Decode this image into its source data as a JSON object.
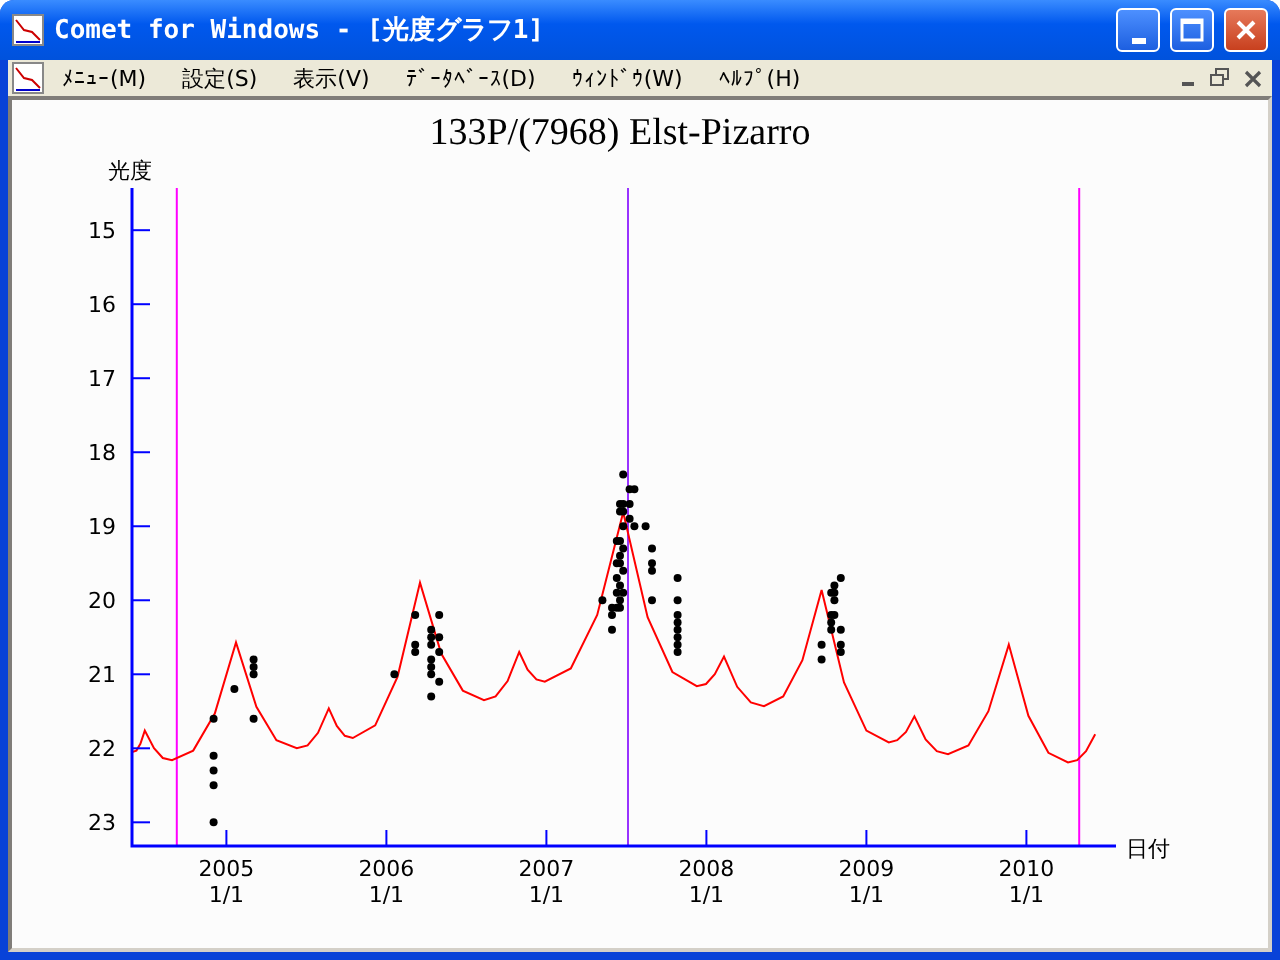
{
  "window": {
    "title": "Comet for Windows - [光度グラフ1]"
  },
  "menu": [
    "ﾒﾆｭｰ(M)",
    "設定(S)",
    "表示(V)",
    "ﾃﾞｰﾀﾍﾞｰｽ(D)",
    "ｳｨﾝﾄﾞｳ(W)",
    "ﾍﾙﾌﾟ(H)"
  ],
  "graph": {
    "xtick_sublabels": [
      "1/1",
      "1/1",
      "1/1",
      "1/1",
      "1/1",
      "1/1"
    ],
    "chart_data": {
      "type": "line",
      "title": "133P/(7968) Elst-Pizarro",
      "xlabel": "日付",
      "ylabel": "光度",
      "xlim": [
        2004.41,
        2010.56
      ],
      "ylim": [
        23.32,
        14.43
      ],
      "yticks": [
        15,
        16,
        17,
        18,
        19,
        20,
        21,
        22,
        23
      ],
      "xticks": [
        2005,
        2006,
        2007,
        2008,
        2009,
        2010
      ],
      "series": [
        {
          "type": "line",
          "color": "#ff0000",
          "x": [
            2004.41,
            2004.437,
            2004.463,
            2004.49,
            2004.547,
            2004.603,
            2004.66,
            2004.793,
            2004.927,
            2005.06,
            2005.187,
            2005.313,
            2005.44,
            2005.507,
            2005.573,
            2005.64,
            2005.69,
            2005.74,
            2005.79,
            2005.93,
            2006.07,
            2006.21,
            2006.343,
            2006.477,
            2006.61,
            2006.683,
            2006.757,
            2006.83,
            2006.883,
            2006.937,
            2006.99,
            2007.153,
            2007.317,
            2007.48,
            2007.633,
            2007.787,
            2007.94,
            2007.997,
            2008.053,
            2008.11,
            2008.193,
            2008.277,
            2008.36,
            2008.48,
            2008.6,
            2008.72,
            2008.86,
            2009.0,
            2009.14,
            2009.193,
            2009.247,
            2009.3,
            2009.37,
            2009.44,
            2009.51,
            2009.637,
            2009.763,
            2009.89,
            2010.013,
            2010.137,
            2010.26,
            2010.317,
            2010.373,
            2010.43
          ],
          "values": [
            22.05,
            22.03,
            21.94,
            21.76,
            22.0,
            22.13,
            22.16,
            22.03,
            21.53,
            20.57,
            21.44,
            21.89,
            22.0,
            21.96,
            21.79,
            21.46,
            21.7,
            21.83,
            21.86,
            21.69,
            21.03,
            19.76,
            20.72,
            21.22,
            21.35,
            21.3,
            21.09,
            20.7,
            20.94,
            21.07,
            21.1,
            20.92,
            20.2,
            18.81,
            20.23,
            20.97,
            21.16,
            21.13,
            21.0,
            20.76,
            21.17,
            21.38,
            21.43,
            21.3,
            20.81,
            19.86,
            21.11,
            21.76,
            21.92,
            21.89,
            21.78,
            21.57,
            21.88,
            22.04,
            22.08,
            21.96,
            21.5,
            20.6,
            21.56,
            22.06,
            22.19,
            22.16,
            22.04,
            21.81
          ]
        },
        {
          "type": "scatter",
          "color": "#000000",
          "x": [
            2004.92,
            2004.92,
            2004.92,
            2004.92,
            2004.92,
            2005.05,
            2005.17,
            2005.17,
            2005.17,
            2005.17,
            2006.05,
            2006.18,
            2006.18,
            2006.18,
            2006.28,
            2006.28,
            2006.28,
            2006.28,
            2006.28,
            2006.28,
            2006.28,
            2006.33,
            2006.33,
            2006.33,
            2006.33,
            2007.35,
            2007.41,
            2007.41,
            2007.41,
            2007.44,
            2007.44,
            2007.44,
            2007.44,
            2007.44,
            2007.46,
            2007.46,
            2007.46,
            2007.46,
            2007.46,
            2007.46,
            2007.46,
            2007.46,
            2007.48,
            2007.48,
            2007.48,
            2007.48,
            2007.48,
            2007.48,
            2007.48,
            2007.52,
            2007.52,
            2007.52,
            2007.55,
            2007.55,
            2007.62,
            2007.66,
            2007.66,
            2007.66,
            2007.66,
            2007.82,
            2007.82,
            2007.82,
            2007.82,
            2007.82,
            2007.82,
            2007.82,
            2007.82,
            2008.72,
            2008.72,
            2008.78,
            2008.78,
            2008.78,
            2008.78,
            2008.8,
            2008.8,
            2008.8,
            2008.8,
            2008.84,
            2008.84,
            2008.84,
            2008.84
          ],
          "values": [
            21.6,
            22.1,
            22.3,
            22.5,
            23.0,
            21.2,
            20.8,
            20.9,
            21.0,
            21.6,
            21.0,
            20.2,
            20.6,
            20.7,
            20.4,
            20.5,
            20.6,
            20.8,
            20.9,
            21.0,
            21.3,
            20.2,
            20.5,
            20.7,
            21.1,
            20.0,
            20.1,
            20.2,
            20.4,
            19.2,
            19.5,
            19.7,
            19.9,
            20.1,
            18.7,
            18.8,
            19.2,
            19.4,
            19.5,
            19.8,
            20.0,
            20.1,
            18.3,
            18.7,
            18.8,
            19.0,
            19.3,
            19.6,
            19.9,
            18.5,
            18.7,
            18.9,
            18.5,
            19.0,
            19.0,
            19.3,
            19.5,
            19.6,
            20.0,
            19.7,
            20.0,
            20.2,
            20.3,
            20.4,
            20.5,
            20.6,
            20.7,
            20.6,
            20.8,
            19.9,
            20.2,
            20.3,
            20.4,
            19.8,
            19.9,
            20.0,
            20.2,
            19.7,
            20.4,
            20.6,
            20.7
          ]
        }
      ],
      "ref_lines": [
        {
          "axis": "x",
          "value": 2004.69,
          "color": "#ff00ff"
        },
        {
          "axis": "x",
          "value": 2007.51,
          "color": "#9933ff"
        },
        {
          "axis": "x",
          "value": 2010.33,
          "color": "#ff00ff"
        }
      ]
    }
  }
}
